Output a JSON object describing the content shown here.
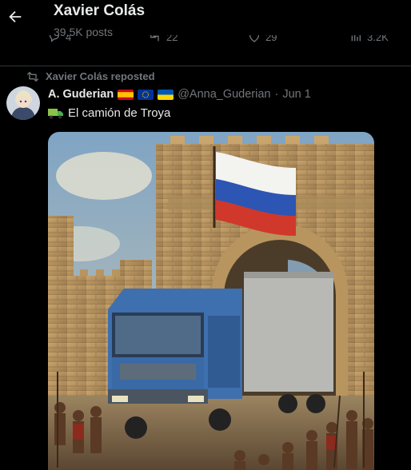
{
  "header": {
    "title": "Xavier Colás",
    "post_count": "39.5K posts"
  },
  "previous_post_actions": {
    "replies": "4",
    "reposts": "22",
    "likes": "29",
    "views": "3.2K"
  },
  "post": {
    "repost_label": "Xavier Colás reposted",
    "author_name": "A. Guderian",
    "handle": "@Anna_Guderian",
    "separator": "·",
    "date": "Jun 1",
    "text": "El camión de Troya",
    "icons": [
      "truck-emoji-icon",
      "flag-spain-icon",
      "flag-eu-icon",
      "flag-ukraine-icon"
    ]
  },
  "colors": {
    "background": "#000000",
    "primary_text": "#e7e9ea",
    "secondary_text": "#71767b",
    "divider": "#2f3336"
  }
}
